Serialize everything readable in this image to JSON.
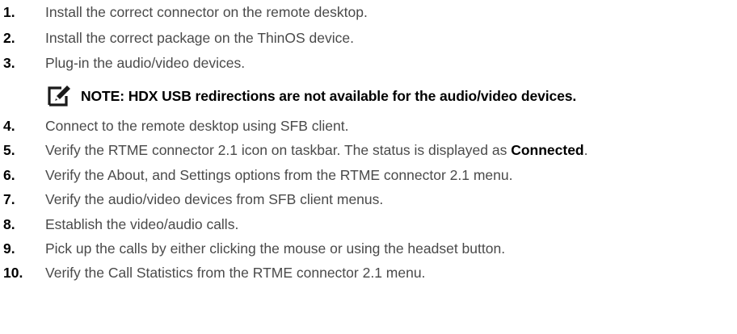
{
  "steps_before_note": [
    {
      "number": "1.",
      "text": "Install the correct connector on the remote desktop."
    },
    {
      "number": "2.",
      "text": "Install the correct package on the ThinOS device."
    },
    {
      "number": "3.",
      "text": "Plug-in the audio/video devices."
    }
  ],
  "note": {
    "icon": "note-pencil-icon",
    "text": "NOTE: HDX USB redirections are not available for the audio/video devices."
  },
  "steps_after_note": [
    {
      "number": "4.",
      "text": "Connect to the remote desktop using SFB client."
    },
    {
      "number": "5.",
      "text_before": "Verify the RTME connector 2.1 icon on taskbar. The status is displayed as ",
      "emphasis": "Connected",
      "text_after": "."
    },
    {
      "number": "6.",
      "text": "Verify the About, and Settings options from the RTME connector 2.1 menu."
    },
    {
      "number": "7.",
      "text": "Verify the audio/video devices from SFB client menus."
    },
    {
      "number": "8.",
      "text": "Establish the video/audio calls."
    },
    {
      "number": "9.",
      "text": "Pick up the calls by either clicking the mouse or using the headset button."
    },
    {
      "number": "10.",
      "text": "Verify the Call Statistics from the RTME connector 2.1 menu."
    }
  ]
}
